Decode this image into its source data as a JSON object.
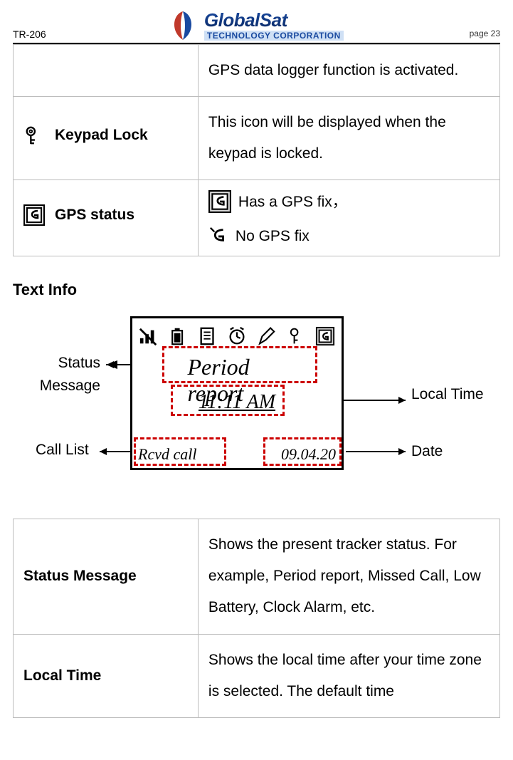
{
  "header": {
    "doc_id": "TR-206",
    "brand_top": "GlobalSat",
    "brand_bottom": "TECHNOLOGY CORPORATION",
    "page_label": "page 23"
  },
  "icon_rows": {
    "row0_desc": "GPS data logger function is activated.",
    "keypad_lock_label": "Keypad Lock",
    "keypad_lock_desc": "This icon will be displayed when the keypad is locked.",
    "gps_status_label": "GPS status",
    "gps_fix_text": "Has a GPS fix，",
    "gps_nofix_text": "No GPS fix"
  },
  "section_title": "Text Info",
  "diagram": {
    "status_message_callout": "Status Message",
    "call_list_callout": "Call List",
    "local_time_callout": "Local Time",
    "date_callout": "Date",
    "lcd_line1": "Period report",
    "lcd_line2": "11:11 AM",
    "lcd_bottom_left": "Rcvd call",
    "lcd_bottom_right": "09.04.20"
  },
  "text_info_rows": {
    "status_message_label": "Status Message",
    "status_message_desc": "Shows the present tracker status. For example, Period report, Missed Call, Low Battery, Clock Alarm, etc.",
    "local_time_label": "Local Time",
    "local_time_desc": "Shows the local time after your time zone is selected. The default time"
  }
}
